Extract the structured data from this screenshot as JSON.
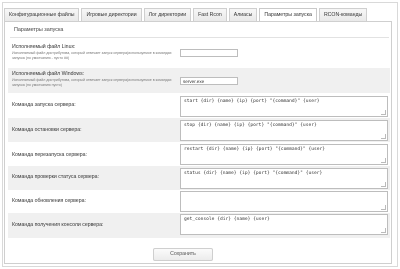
{
  "tabs": [
    {
      "label": "Конфигурационные файлы"
    },
    {
      "label": "Игровые директории"
    },
    {
      "label": "Лог директории"
    },
    {
      "label": "Fast Rcon"
    },
    {
      "label": "Алиасы"
    },
    {
      "label": "Параметры запуска",
      "active": true
    },
    {
      "label": "RCON-команды"
    }
  ],
  "section_title": "Параметры запуска",
  "fields": {
    "linux_exec": {
      "label": "Исполняемый файл Linux:",
      "hint": "Исполняемый файл дистрибутива, который отвечает запуск сервера(используемое в командах запуска (по умолчанию - пусто ##)",
      "value": ""
    },
    "windows_exec": {
      "label": "Исполняемый файл Windows:",
      "hint": "Исполняемый файл дистрибутива, который отвечает запуск сервера(используемое в командах запуска (по умолчанию пусто)",
      "value": "server.exe"
    },
    "start_cmd": {
      "label": "Команда запуска сервера:",
      "value": "start {dir} {name} {ip} {port} \"{command}\" {user}"
    },
    "stop_cmd": {
      "label": "Команда остановки сервера:",
      "value": "stop {dir} {name} {ip} {port} \"{command}\" {user}"
    },
    "restart_cmd": {
      "label": "Команда перезапуска сервера:",
      "value": "restart {dir} {name} {ip} {port} \"{command}\" {user}"
    },
    "status_cmd": {
      "label": "Команда проверки статуса сервера:",
      "value": "status {dir} {name} {ip} {port} \"{command}\" {user}"
    },
    "update_cmd": {
      "label": "Команда обновления сервера:",
      "value": ""
    },
    "console_cmd": {
      "label": "Команда получения консоли сервера:",
      "value": "get_console {dir} {name} {user}"
    }
  },
  "save_label": "Сохранить"
}
